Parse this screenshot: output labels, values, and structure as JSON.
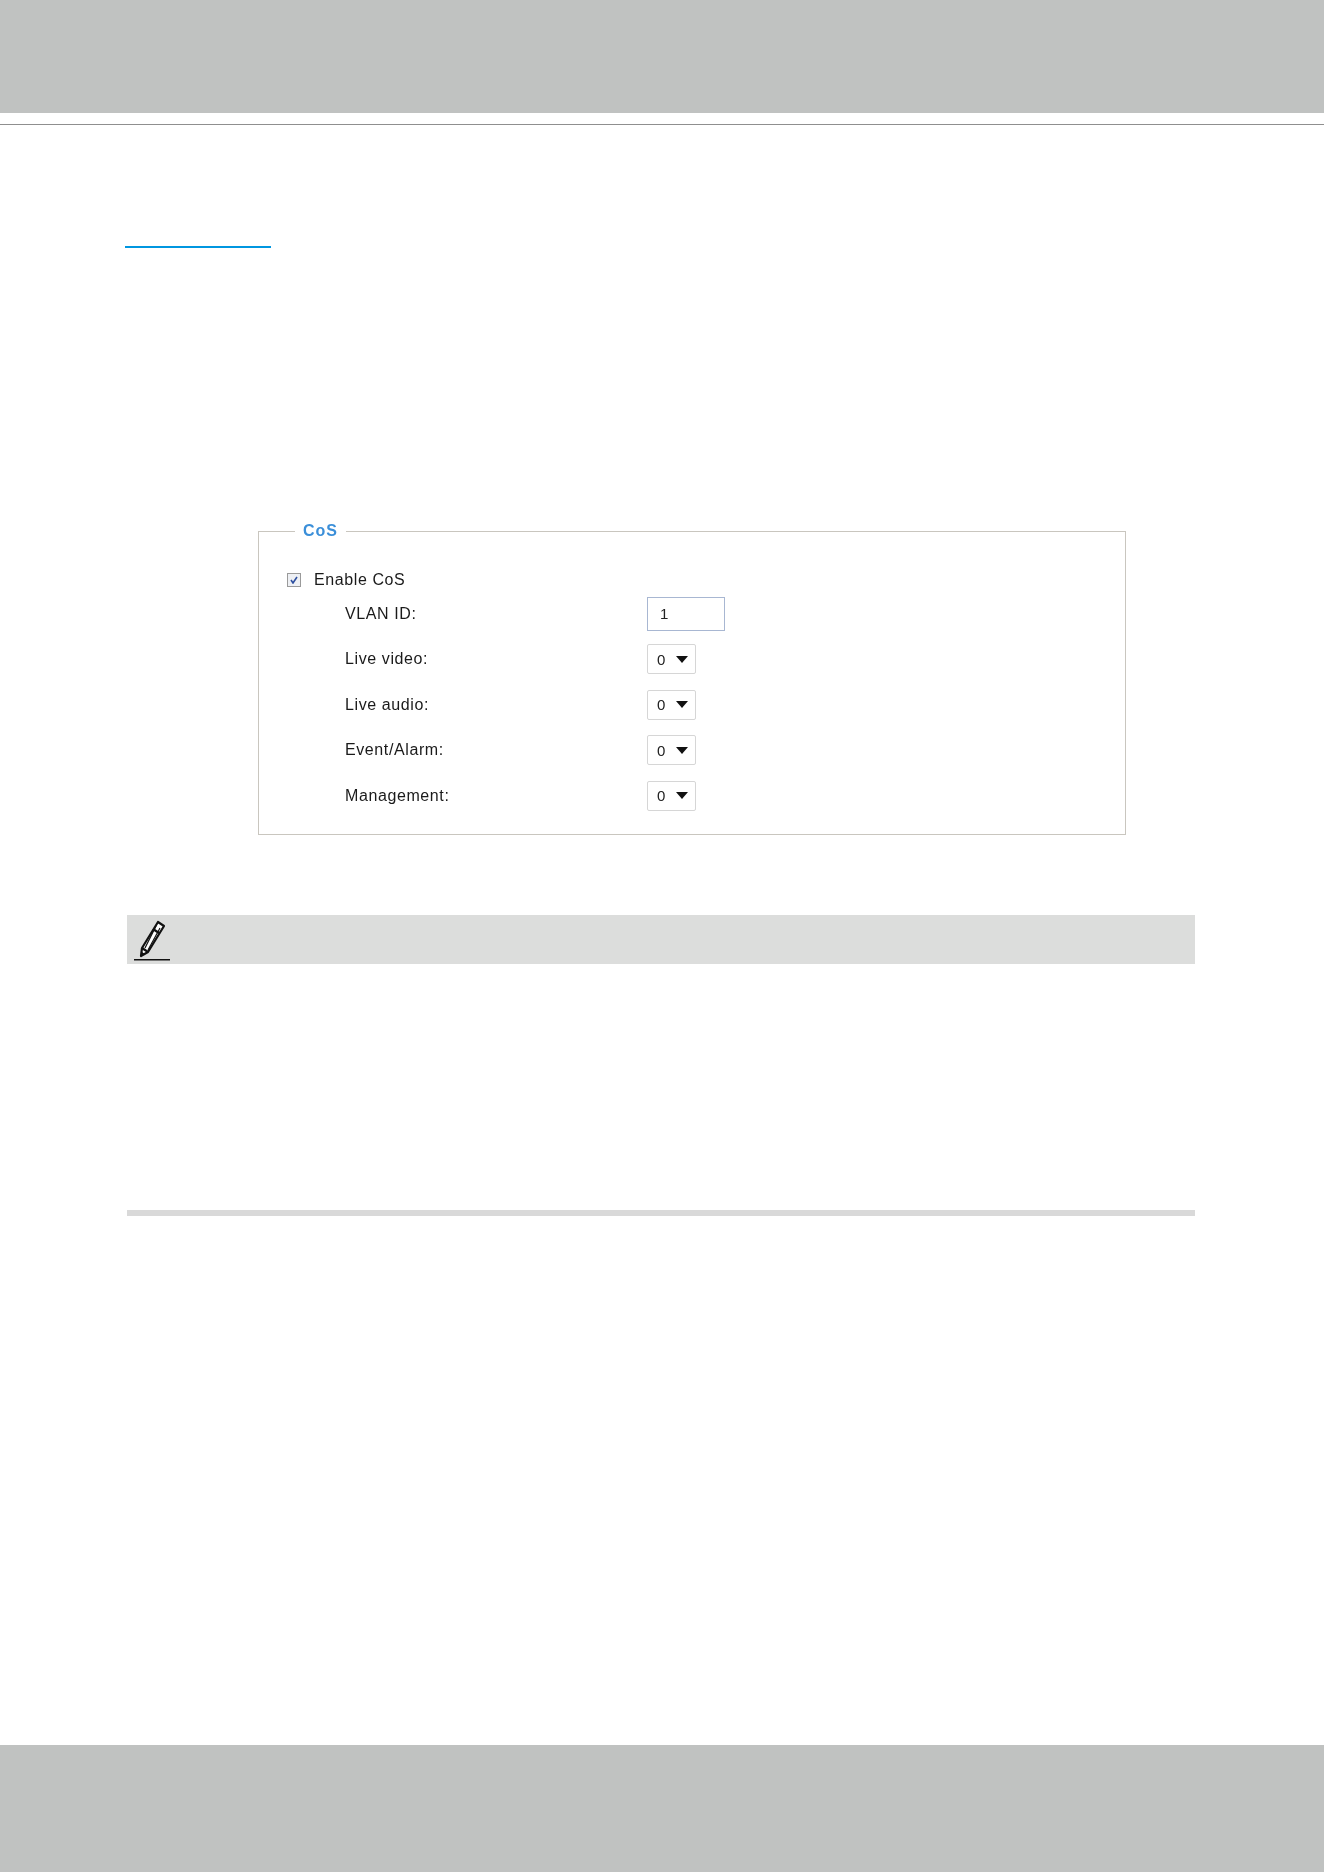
{
  "cos": {
    "legend": "CoS",
    "enable": {
      "label": "Enable CoS",
      "checked": true
    },
    "fields": [
      {
        "kind": "text",
        "label": "VLAN ID:",
        "value": "1"
      },
      {
        "kind": "select",
        "label": "Live video:",
        "value": "0"
      },
      {
        "kind": "select",
        "label": "Live audio:",
        "value": "0"
      },
      {
        "kind": "select",
        "label": "Event/Alarm:",
        "value": "0"
      },
      {
        "kind": "select",
        "label": "Management:",
        "value": "0"
      }
    ]
  }
}
